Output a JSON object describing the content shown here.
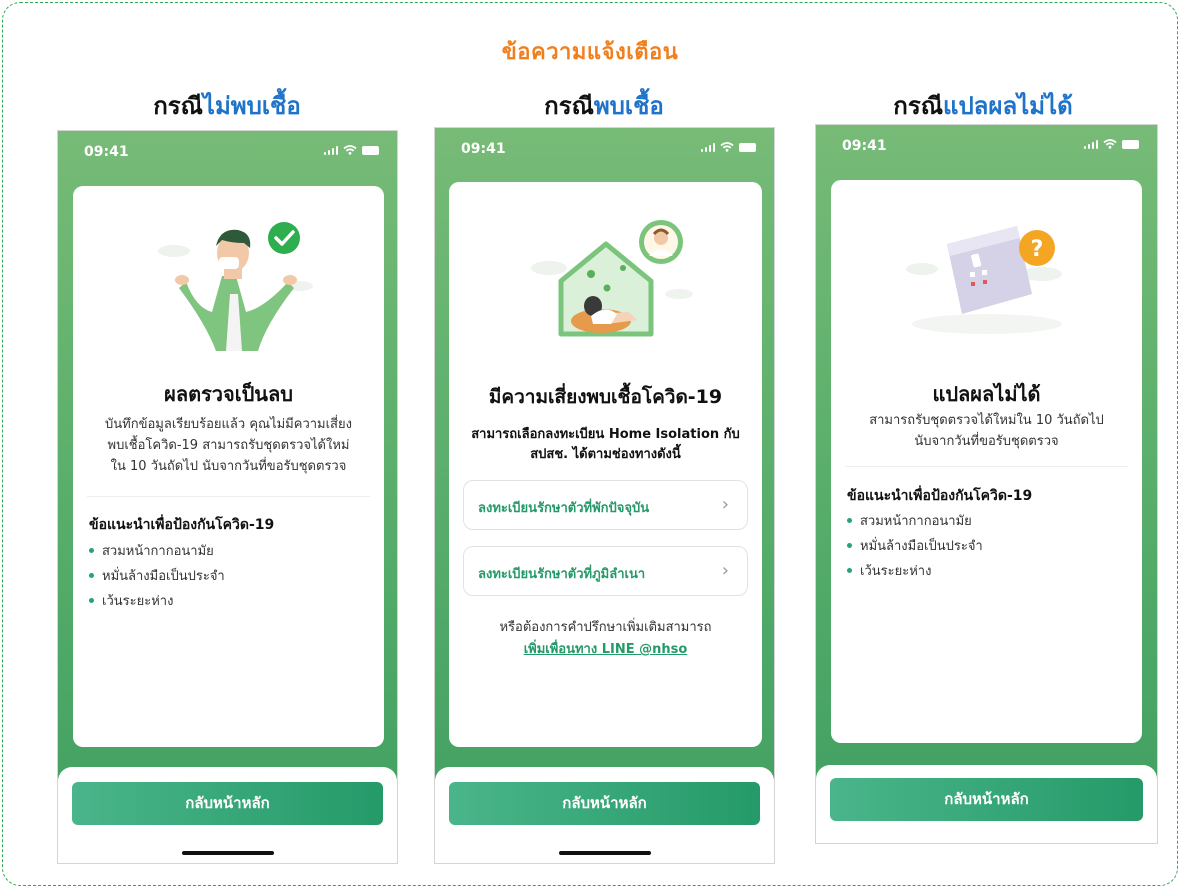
{
  "header": {
    "title": "ข้อความแจ้งเตือน"
  },
  "cases": [
    {
      "prefix": "กรณี",
      "highlight": "ไม่พบเชื้อ"
    },
    {
      "prefix": "กรณี",
      "highlight": "พบเชื้อ"
    },
    {
      "prefix": "กรณี",
      "highlight": "แปลผลไม่ได้"
    }
  ],
  "status": {
    "time": "09:41"
  },
  "colors": {
    "accent": "#259a69",
    "title_orange": "#f07f1f",
    "highlight_blue": "#1f73c8"
  },
  "negative": {
    "title": "ผลตรวจเป็นลบ",
    "body": [
      "บันทึกข้อมูลเรียบร้อยแล้ว คุณไม่มีความเสี่ยง",
      "พบเชื้อโควิด-19 สามารถรับชุดตรวจได้ใหม่",
      "ใน 10 วันถัดไป นับจากวันที่ขอรับชุดตรวจ"
    ],
    "tips_title": "ข้อแนะนำเพื่อป้องกันโควิด-19",
    "tips": [
      "สวมหน้ากากอนามัย",
      "หมั่นล้างมือเป็นประจำ",
      "เว้นระยะห่าง"
    ],
    "button": "กลับหน้าหลัก"
  },
  "positive": {
    "title": "มีความเสี่ยงพบเชื้อโควิด-19",
    "body": [
      "สามารถเลือกลงทะเบียน Home Isolation กับ",
      "สปสช. ได้ตามช่องทางดังนี้"
    ],
    "options": [
      "ลงทะเบียนรักษาตัวที่พักปัจจุบัน",
      "ลงทะเบียนรักษาตัวที่ภูมิลำเนา"
    ],
    "note": "หรือต้องการคำปรึกษาเพิ่มเติมสามารถ",
    "link": "เพิ่มเพื่อนทาง LINE @nhso",
    "button": "กลับหน้าหลัก"
  },
  "invalid": {
    "title": "แปลผลไม่ได้",
    "body": [
      "สามารถรับชุดตรวจได้ใหม่ใน 10 วันถัดไป",
      "นับจากวันที่ขอรับชุดตรวจ"
    ],
    "tips_title": "ข้อแนะนำเพื่อป้องกันโควิด-19",
    "tips": [
      "สวมหน้ากากอนามัย",
      "หมั่นล้างมือเป็นประจำ",
      "เว้นระยะห่าง"
    ],
    "button": "กลับหน้าหลัก"
  }
}
